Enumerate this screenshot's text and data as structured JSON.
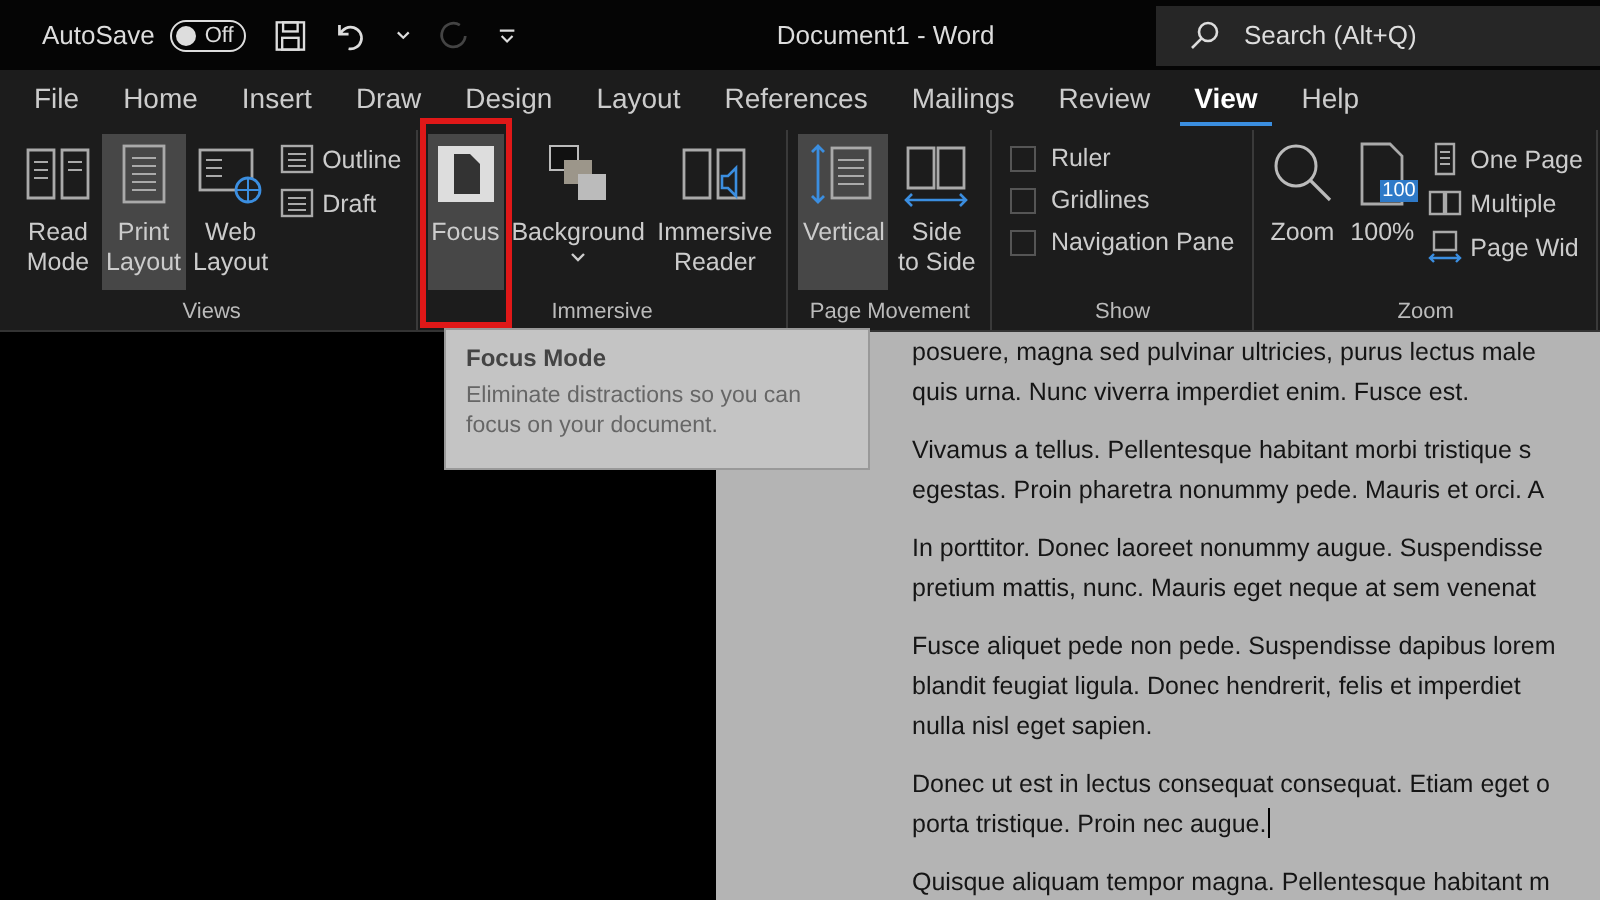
{
  "title_bar": {
    "autosave_label": "AutoSave",
    "autosave_toggle": {
      "label": "Off",
      "on": false
    },
    "redo_disabled": true,
    "document_title": "Document1  -  Word",
    "search": {
      "placeholder": "Search (Alt+Q)"
    }
  },
  "tabs": [
    {
      "label": "File",
      "selected": false
    },
    {
      "label": "Home",
      "selected": false
    },
    {
      "label": "Insert",
      "selected": false
    },
    {
      "label": "Draw",
      "selected": false
    },
    {
      "label": "Design",
      "selected": false
    },
    {
      "label": "Layout",
      "selected": false
    },
    {
      "label": "References",
      "selected": false
    },
    {
      "label": "Mailings",
      "selected": false
    },
    {
      "label": "Review",
      "selected": false
    },
    {
      "label": "View",
      "selected": true
    },
    {
      "label": "Help",
      "selected": false
    }
  ],
  "ribbon_groups": [
    {
      "label": "Views",
      "items": [
        {
          "kind": "big",
          "label": [
            "Read",
            "Mode"
          ],
          "selected": false,
          "highlighted": false
        },
        {
          "kind": "big",
          "label": [
            "Print",
            "Layout"
          ],
          "selected": true,
          "highlighted": false
        },
        {
          "kind": "big",
          "label": [
            "Web",
            "Layout"
          ],
          "selected": false,
          "highlighted": false
        },
        {
          "kind": "small",
          "label": [
            "Outline"
          ]
        },
        {
          "kind": "small",
          "label": [
            "Draft"
          ]
        }
      ]
    },
    {
      "label": "Immersive",
      "items": [
        {
          "kind": "big",
          "label": [
            "Focus"
          ],
          "selected": true,
          "highlighted": true
        },
        {
          "kind": "big",
          "label": [
            "Background"
          ],
          "selected": false,
          "highlighted": false,
          "dropdown": true
        },
        {
          "kind": "big",
          "label": [
            "Immersive",
            "Reader"
          ],
          "selected": false,
          "highlighted": false
        }
      ]
    },
    {
      "label": "Page Movement",
      "items": [
        {
          "kind": "big",
          "label": [
            "Vertical"
          ],
          "selected": true,
          "highlighted": false
        },
        {
          "kind": "big",
          "label": [
            "Side",
            "to Side"
          ],
          "selected": false,
          "highlighted": false
        }
      ]
    },
    {
      "label": "Show",
      "items": [
        {
          "kind": "check",
          "label": [
            "Ruler"
          ],
          "checked": false
        },
        {
          "kind": "check",
          "label": [
            "Gridlines"
          ],
          "checked": false
        },
        {
          "kind": "check",
          "label": [
            "Navigation Pane"
          ],
          "checked": false
        }
      ]
    },
    {
      "label": "Zoom",
      "items": [
        {
          "kind": "big",
          "label": [
            "Zoom"
          ],
          "selected": false,
          "highlighted": false
        },
        {
          "kind": "big",
          "label": [
            "100%"
          ],
          "selected": false,
          "highlighted": false,
          "badge": "100"
        },
        {
          "kind": "small",
          "label": [
            "One Page"
          ]
        },
        {
          "kind": "small",
          "label": [
            "Multiple"
          ]
        },
        {
          "kind": "small",
          "label": [
            "Page Wid"
          ]
        }
      ]
    }
  ],
  "tooltip": {
    "title": "Focus Mode",
    "text": "Eliminate distractions so you can focus on your document."
  },
  "document": {
    "paragraphs": [
      {
        "lines": [
          "posuere, magna sed pulvinar ultricies, purus lectus male",
          "quis urna. Nunc viverra imperdiet enim. Fusce est."
        ],
        "cursor": false
      },
      {
        "lines": [
          "Vivamus a tellus. Pellentesque habitant morbi tristique s",
          "egestas. Proin pharetra nonummy pede. Mauris et orci. A"
        ],
        "cursor": false
      },
      {
        "lines": [
          "In porttitor. Donec laoreet nonummy augue. Suspendisse",
          "pretium mattis, nunc. Mauris eget neque at sem venenat"
        ],
        "cursor": false
      },
      {
        "lines": [
          "Fusce aliquet pede non pede. Suspendisse dapibus lorem",
          "blandit feugiat ligula. Donec hendrerit, felis et imperdiet",
          "nulla nisl eget sapien."
        ],
        "cursor": false
      },
      {
        "lines": [
          "Donec ut est in lectus consequat consequat. Etiam eget o",
          "porta tristique. Proin nec augue."
        ],
        "cursor": true
      },
      {
        "lines": [
          "Quisque aliquam tempor magna. Pellentesque habitant m"
        ],
        "cursor": false
      }
    ]
  }
}
